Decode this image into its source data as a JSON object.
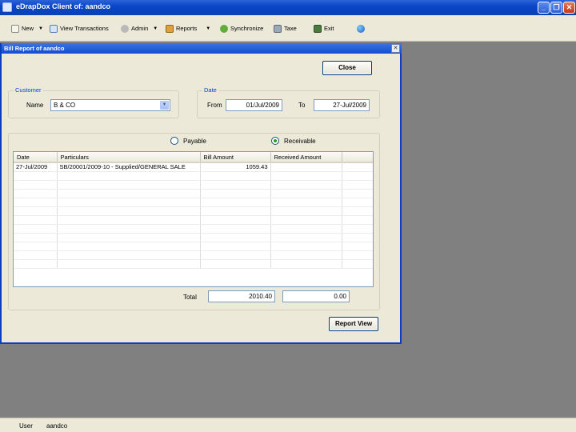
{
  "app": {
    "title": "eDrapDox Client of: aandco"
  },
  "toolbar": {
    "new": "New",
    "view_transactions": "View Transactions",
    "admin": "Admin",
    "reports": "Reports",
    "synchronize": "Synchronize",
    "tax": "Taxe",
    "exit": "Exit"
  },
  "dialog": {
    "title": "Bill Report of aandco",
    "close_label": "Close",
    "customer": {
      "legend": "Customer",
      "name_label": "Name",
      "name_value": "B & CO"
    },
    "date": {
      "legend": "Date",
      "from_label": "From",
      "from_value": "01/Jul/2009",
      "to_label": "To",
      "to_value": "27-Jul/2009"
    },
    "options": {
      "payable": "Payable",
      "receivable": "Receivable",
      "selected": "receivable"
    },
    "grid": {
      "columns": [
        "Date",
        "Particulars",
        "Bill Amount",
        "Received Amount"
      ],
      "rows": [
        [
          "27-Jul/2009",
          "SB/20001/2009-10 - Supplied/GENERAL SALE",
          "1059.43",
          ""
        ]
      ]
    },
    "total_label": "Total",
    "total_bill": "2010.40",
    "total_received": "0.00",
    "report_view_label": "Report View"
  },
  "status": {
    "user_label": "User",
    "user_value": "aandco"
  },
  "colors": {
    "titlebar": "#0a46c9",
    "window_bg": "#ece9d8",
    "desktop": "#808080"
  }
}
